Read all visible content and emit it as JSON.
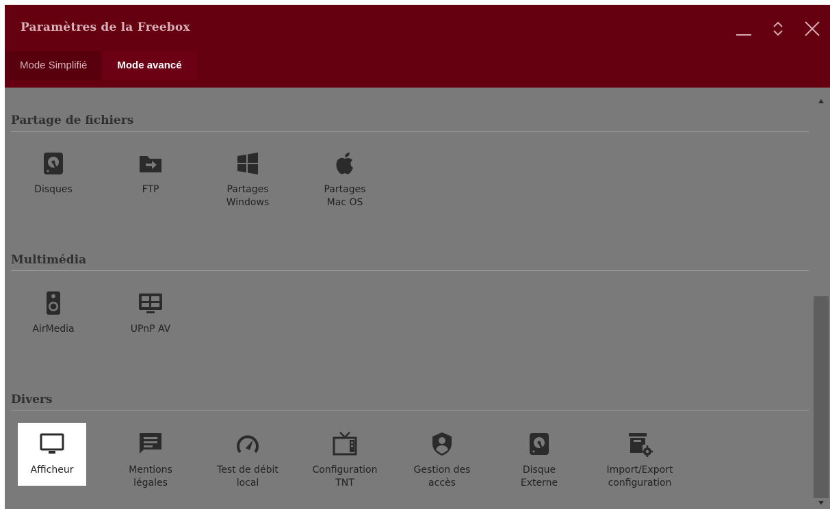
{
  "window": {
    "title": "Paramètres de la Freebox",
    "controls": [
      "minimize-icon",
      "restore-icon",
      "close-icon"
    ]
  },
  "tabs": [
    {
      "label": "Mode Simplifié",
      "active": false
    },
    {
      "label": "Mode avancé",
      "active": true
    }
  ],
  "sections": [
    {
      "title": "Partage de fichiers",
      "items": [
        {
          "label": "Disques",
          "icon": "hard-disk-icon"
        },
        {
          "label": "FTP",
          "icon": "folder-arrow-icon"
        },
        {
          "label": "Partages Windows",
          "icon": "windows-logo-icon"
        },
        {
          "label": "Partages Mac OS",
          "icon": "apple-logo-icon"
        }
      ]
    },
    {
      "title": "Multimédia",
      "items": [
        {
          "label": "AirMedia",
          "icon": "speaker-icon"
        },
        {
          "label": "UPnP AV",
          "icon": "media-screen-icon"
        }
      ]
    },
    {
      "title": "Divers",
      "items": [
        {
          "label": "Afficheur",
          "icon": "monitor-icon",
          "selected": true
        },
        {
          "label": "Mentions légales",
          "icon": "message-icon"
        },
        {
          "label": "Test de débit local",
          "icon": "speedometer-icon"
        },
        {
          "label": "Configuration TNT",
          "icon": "tv-icon"
        },
        {
          "label": "Gestion des accès",
          "icon": "user-shield-icon"
        },
        {
          "label": "Disque Externe",
          "icon": "external-disk-icon"
        },
        {
          "label": "Import/Export configuration",
          "icon": "archive-gear-icon"
        }
      ]
    }
  ],
  "colors": {
    "titlebar": "#640010",
    "tab_inactive": "#58000e",
    "tab_active": "#6c0014",
    "content_bg": "#7a7a7a",
    "scroll_thumb": "#5e5e5e",
    "selected_bg": "#ffffff"
  }
}
